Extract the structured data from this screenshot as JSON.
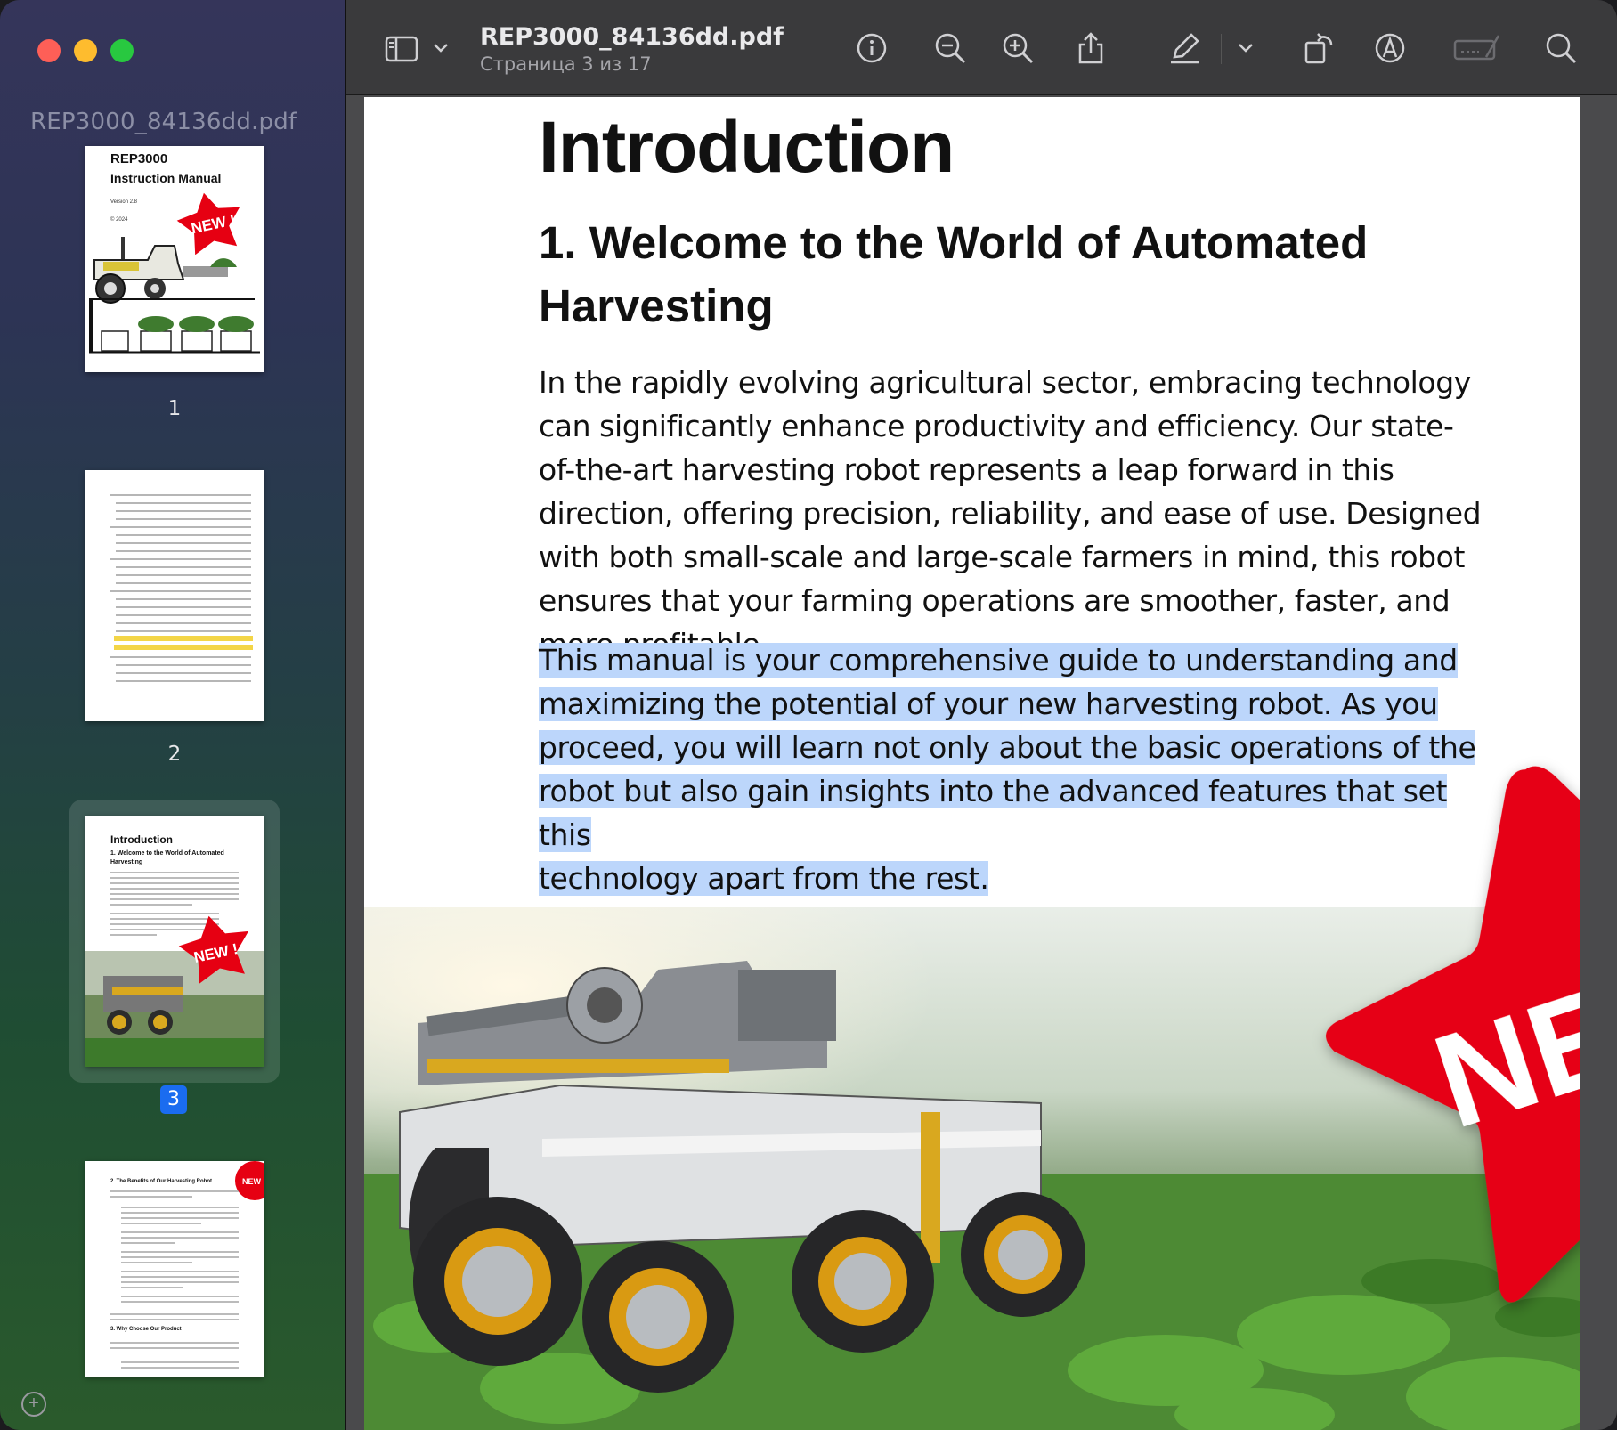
{
  "window": {
    "sidebar_title": "REP3000_84136dd.pdf",
    "doc_title": "REP3000_84136dd.pdf",
    "doc_subtitle": "Страница 3 из 17"
  },
  "toolbar": {
    "icons": [
      "sidebar-toggle-icon",
      "chevron-down-icon",
      "info-icon",
      "zoom-out-icon",
      "zoom-in-icon",
      "share-icon",
      "markup-pen-icon",
      "chevron-down-icon",
      "rotate-icon",
      "highlight-icon",
      "form-fill-icon",
      "search-icon"
    ]
  },
  "thumbnails": [
    {
      "number": "1",
      "title": "REP3000",
      "subtitle": "Instruction Manual",
      "version": "Version 2.8",
      "copyright": "© 2024",
      "badge": "NEW !"
    },
    {
      "number": "2"
    },
    {
      "number": "3",
      "heading": "Introduction",
      "subheading": "1. Welcome to the World of Automated Harvesting",
      "badge": "NEW !"
    },
    {
      "number": "4",
      "heading": "2. The Benefits of Our Harvesting Robot",
      "badge": "NEW",
      "section": "3. Why Choose Our Product"
    }
  ],
  "page": {
    "heading": "Introduction",
    "subheading": "1. Welcome to the World of Automated Harvesting",
    "paragraph1": "In the rapidly evolving agricultural sector, embracing technology can significantly enhance productivity and efficiency. Our state-of-the-art harvesting robot represents a leap forward in this direction, offering precision, reliability, and ease of use. Designed with both small-scale and large-scale farmers in mind, this robot ensures that your farming operations are smoother, faster, and more profitable.",
    "paragraph2_lines": [
      "This manual is your comprehensive guide to understanding and",
      "maximizing the potential of your new harvesting robot. As you",
      "proceed, you will learn not only about the basic operations of the",
      "robot but also gain insights into the advanced features that set this",
      "technology apart from the rest."
    ],
    "badge": "NEW !"
  },
  "colors": {
    "selection": "#bcd6fb",
    "badge_red": "#e60012",
    "selected_page_badge": "#1a6cf0"
  }
}
